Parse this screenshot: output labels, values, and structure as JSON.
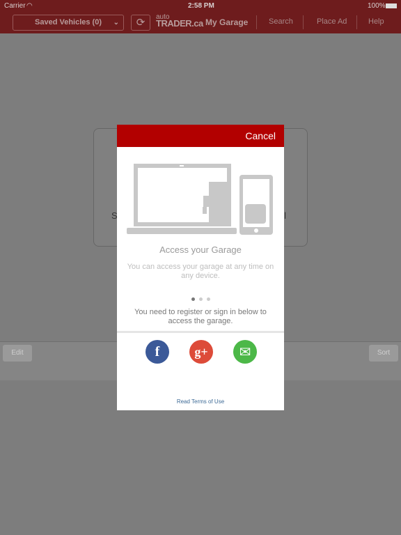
{
  "status_bar": {
    "carrier": "Carrier",
    "time": "2:58 PM",
    "battery": "100%"
  },
  "nav": {
    "saved_vehicles": "Saved Vehicles (0)",
    "logo_top": "auto",
    "logo_bottom": "TRADER.ca",
    "my_garage": "My Garage",
    "search": "Search",
    "place_ad": "Place Ad",
    "help": "Help"
  },
  "background": {
    "left_fragment": "S",
    "right_fragment": "ail",
    "edit": "Edit",
    "sort": "Sort"
  },
  "modal": {
    "cancel": "Cancel",
    "title": "Access your Garage",
    "description": "You can access your garage at any time on any device.",
    "page_indicator": {
      "current": 1,
      "total": 3
    },
    "note": "You need to register or sign in below to access the garage.",
    "social": [
      {
        "name": "facebook",
        "glyph": "f",
        "color": "#3b5998"
      },
      {
        "name": "google-plus",
        "glyph": "g+",
        "color": "#dd4b39"
      },
      {
        "name": "email",
        "glyph": "✉",
        "color": "#4cb848"
      }
    ],
    "terms": "Read Terms of Use",
    "accent": "#b20000"
  }
}
